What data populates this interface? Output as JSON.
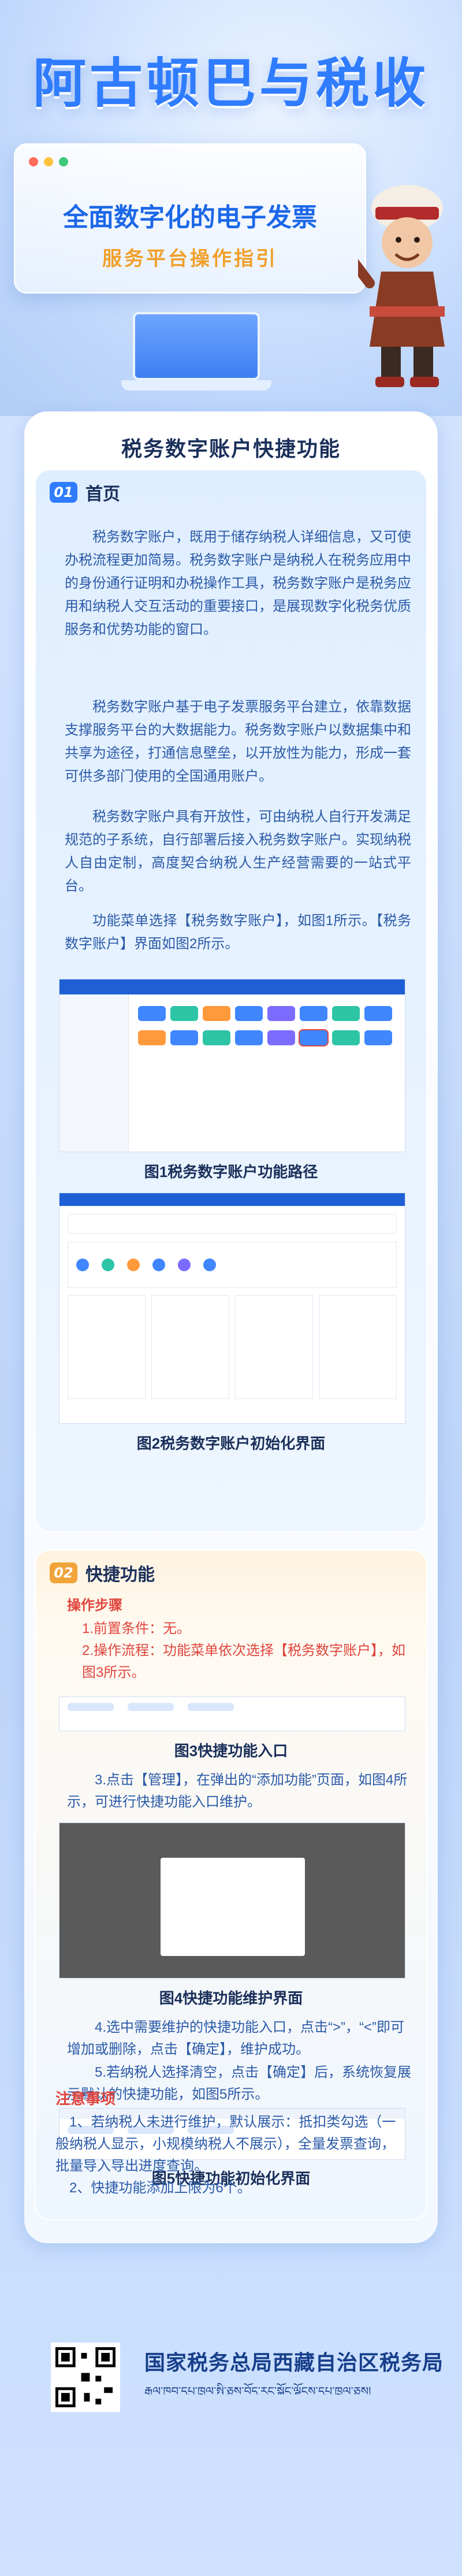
{
  "header": {
    "title": "阿古顿巴与税收",
    "browser_line1": "全面数字化的电子发票",
    "browser_line2": "服务平台操作指引",
    "colors": {
      "accent": "#2f7cff",
      "orange": "#f19f2a"
    }
  },
  "card": {
    "title": "税务数字账户快捷功能",
    "section1": {
      "num": "01",
      "label": "首页",
      "paragraphs": [
        "税务数字账户，既用于储存纳税人详细信息，又可使办税流程更加简易。税务数字账户是纳税人在税务应用中的身份通行证明和办税操作工具，税务数字账户是税务应用和纳税人交互活动的重要接口，是展现数字化税务优质服务和优势功能的窗口。",
        "税务数字账户基于电子发票服务平台建立，依靠数据支撑服务平台的大数据能力。税务数字账户以数据集中和共享为途径，打通信息壁垒，以开放性为能力，形成一套可供多部门使用的全国通用账户。",
        "税务数字账户具有开放性，可由纳税人自行开发满足规范的子系统，自行部署后接入税务数字账户。实现纳税人自由定制，高度契合纳税人生产经营需要的一站式平台。",
        "功能菜单选择【税务数字账户】，如图1所示。【税务数字账户】界面如图2所示。"
      ],
      "fig1_caption": "图1税务数字账户功能路径",
      "fig2_caption": "图2税务数字账户初始化界面"
    },
    "section2": {
      "num": "02",
      "label": "快捷功能",
      "steps_title": "操作步骤",
      "step1": "1.前置条件：无。",
      "step2": "2.操作流程：功能菜单依次选择【税务数字账户】，如图3所示。",
      "fig3_caption": "图3快捷功能入口",
      "step3": "3.点击【管理】，在弹出的“添加功能”页面，如图4所示，可进行快捷功能入口维护。",
      "fig4_caption": "图4快捷功能维护界面",
      "step4": "4.选中需要维护的快捷功能入口，点击“>”，“<”即可增加或删除，点击【确定】，维护成功。",
      "step5": "5.若纳税人选择清空，点击【确定】后，系统恢复展示默认的快捷功能，如图5所示。",
      "fig5_caption": "图5快捷功能初始化界面",
      "notes_title": "注意事项",
      "note1": "1、若纳税人未进行维护，默认展示：抵扣类勾选（一般纳税人显示，小规模纳税人不展示），全量发票查询，批量导入导出进度查询。",
      "note2": "2、快捷功能添加上限为6个。"
    }
  },
  "footer": {
    "title": "国家税务总局西藏自治区税务局",
    "subtitle": "རྒྱལ་ཁབ་དཔྱ་ཁྲལ་སྤྱི་ཅུས་བོད་རང་སྐྱོང་ལྗོངས་དཔྱ་ཁྲལ་ཅུས།"
  }
}
